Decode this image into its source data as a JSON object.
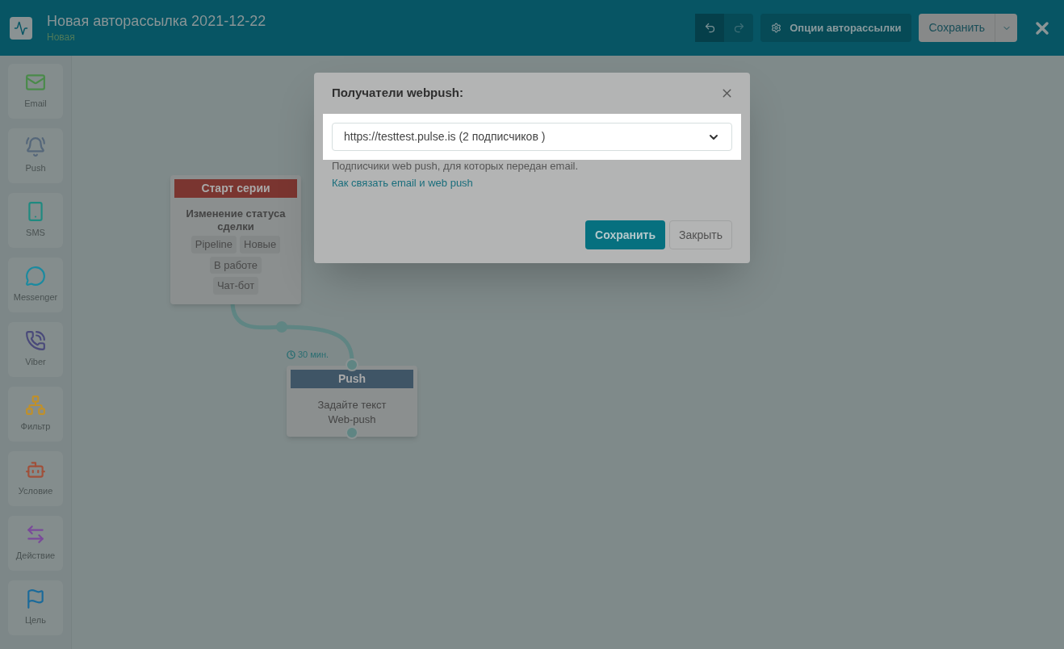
{
  "header": {
    "title": "Новая авторассылка 2021-12-22",
    "status": "Новая",
    "options_button": "Опции авторассылки",
    "save_button": "Сохранить"
  },
  "sidebar": {
    "items": [
      {
        "kind": "email",
        "label": "Email"
      },
      {
        "kind": "push",
        "label": "Push"
      },
      {
        "kind": "sms",
        "label": "SMS"
      },
      {
        "kind": "messenger",
        "label": "Messenger"
      },
      {
        "kind": "viber",
        "label": "Viber"
      },
      {
        "kind": "filter",
        "label": "Фильтр"
      },
      {
        "kind": "condition",
        "label": "Условие"
      },
      {
        "kind": "action",
        "label": "Действие"
      },
      {
        "kind": "goal",
        "label": "Цель"
      }
    ]
  },
  "canvas": {
    "nodes": [
      {
        "kind": "start",
        "header": "Старт серии",
        "title": "Изменение статуса сделки",
        "tags": [
          "Pipeline",
          "Новые",
          "В работе",
          "Чат-бот"
        ]
      },
      {
        "kind": "push",
        "header": "Push",
        "text": "Задайте текст Web-push",
        "delay": "30 мин."
      }
    ]
  },
  "dialog": {
    "title": "Получатели webpush:",
    "select_value": "https://testtest.pulse.is (2 подписчиков )",
    "hint": "Подписчики web push, для которых передан email.",
    "link": "Как связать email и web push",
    "save_button": "Сохранить",
    "close_button": "Закрыть"
  }
}
